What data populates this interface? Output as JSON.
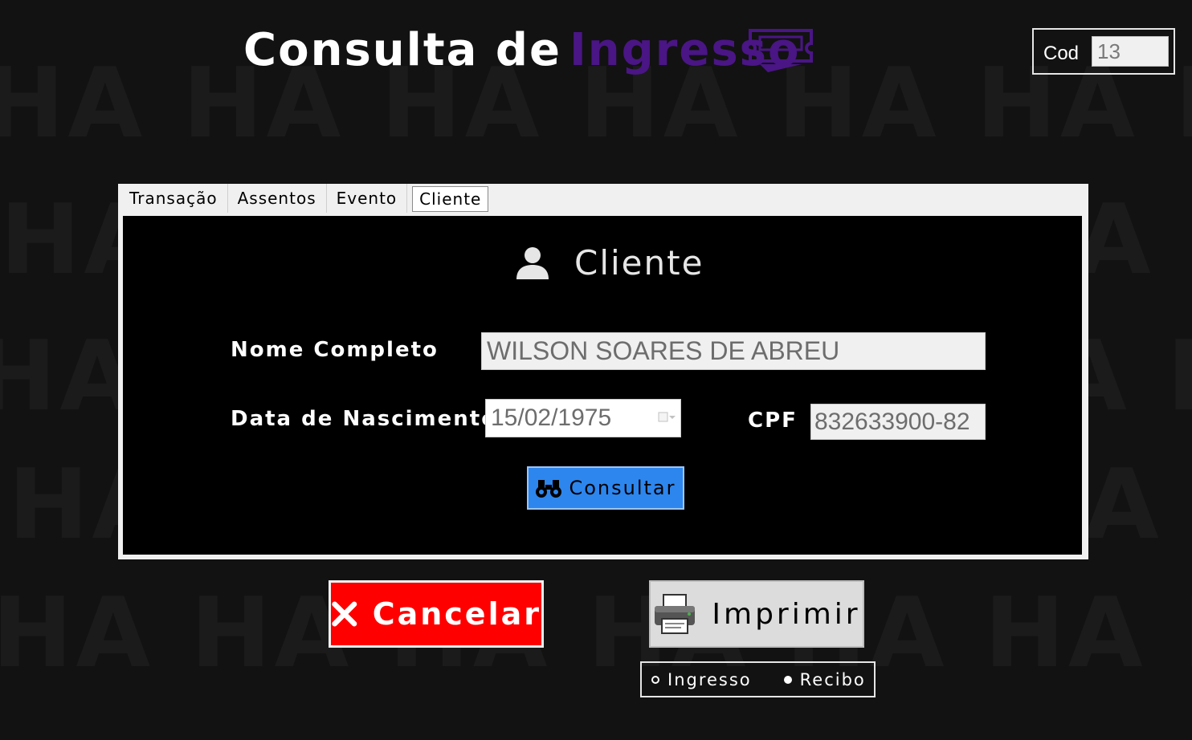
{
  "header": {
    "title_part1": "Consulta de",
    "title_part2": "Ingresso",
    "cod_label": "Cod",
    "cod_value": "13"
  },
  "tabs": [
    {
      "label": "Transação"
    },
    {
      "label": "Assentos"
    },
    {
      "label": "Evento"
    },
    {
      "label": "Cliente",
      "active": true
    }
  ],
  "cliente": {
    "section_title": "Cliente",
    "nome_label": "Nome Completo",
    "nome_value": "WILSON SOARES DE ABREU",
    "nascimento_label": "Data de Nascimento",
    "nascimento_value": "15/02/1975",
    "cpf_label": "CPF",
    "cpf_value": "832633900-82",
    "consultar_label": "Consultar"
  },
  "actions": {
    "cancel_label": "Cancelar",
    "print_label": "Imprimir"
  },
  "print_options": {
    "options": [
      {
        "label": "Ingresso",
        "checked": false
      },
      {
        "label": "Recibo",
        "checked": true
      }
    ]
  },
  "background": {
    "pattern_text": "HA HA HA HA HA HA HA"
  },
  "colors": {
    "accent_purple": "#4a1585",
    "cancel_red": "#ff0000",
    "consultar_blue": "#2d86ee"
  }
}
